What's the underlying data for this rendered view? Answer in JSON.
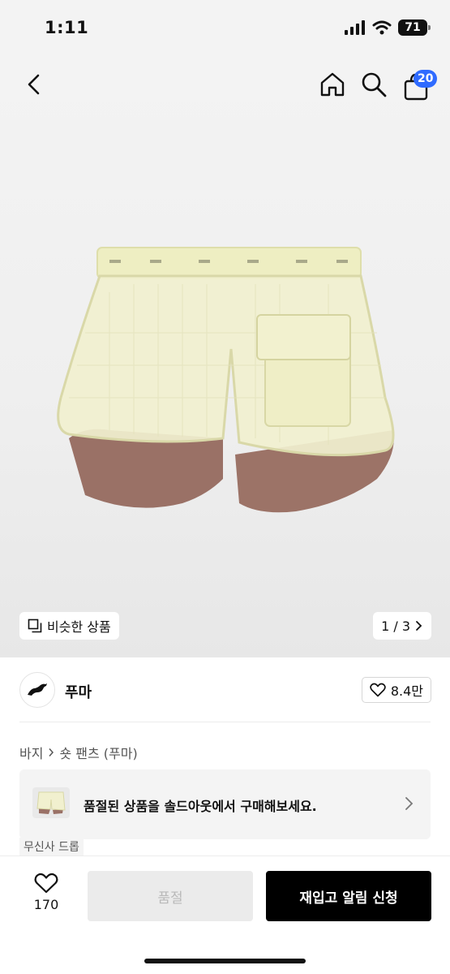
{
  "status_bar": {
    "time": "1:11",
    "battery": "71"
  },
  "nav": {
    "cart_count": "20"
  },
  "gallery": {
    "similar_label": "비슷한 상품",
    "page_indicator": "1 / 3"
  },
  "brand": {
    "name": "푸마",
    "likes": "8.4만"
  },
  "breadcrumb": {
    "category": "바지",
    "subcategory": "숏 팬츠 (푸마)"
  },
  "soldout_banner": {
    "text": "품절된 상품을 솔드아웃에서 구매해보세요."
  },
  "drop_tag": "무신사 드롭",
  "bottom_bar": {
    "wish_count": "170",
    "soldout_label": "품절",
    "restock_label": "재입고 알림 신청"
  },
  "colors": {
    "accent_badge": "#2f6bff",
    "primary_button": "#000000",
    "disabled_button": "#ebebeb"
  }
}
